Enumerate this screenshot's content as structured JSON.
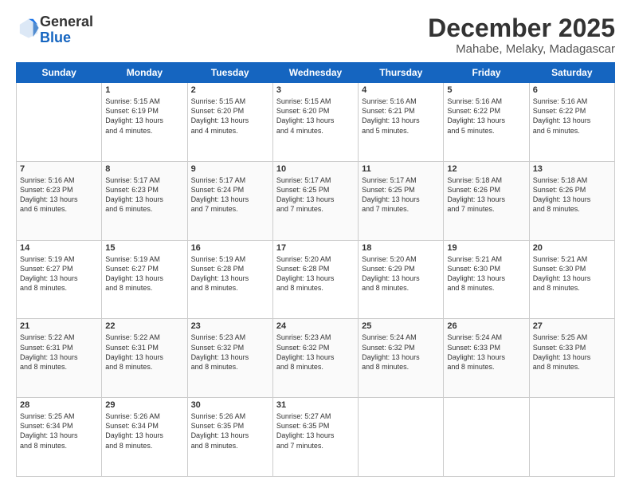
{
  "header": {
    "logo_general": "General",
    "logo_blue": "Blue",
    "title": "December 2025",
    "subtitle": "Mahabe, Melaky, Madagascar"
  },
  "days_of_week": [
    "Sunday",
    "Monday",
    "Tuesday",
    "Wednesday",
    "Thursday",
    "Friday",
    "Saturday"
  ],
  "weeks": [
    [
      {
        "day": "",
        "text": ""
      },
      {
        "day": "1",
        "text": "Sunrise: 5:15 AM\nSunset: 6:19 PM\nDaylight: 13 hours\nand 4 minutes."
      },
      {
        "day": "2",
        "text": "Sunrise: 5:15 AM\nSunset: 6:20 PM\nDaylight: 13 hours\nand 4 minutes."
      },
      {
        "day": "3",
        "text": "Sunrise: 5:15 AM\nSunset: 6:20 PM\nDaylight: 13 hours\nand 4 minutes."
      },
      {
        "day": "4",
        "text": "Sunrise: 5:16 AM\nSunset: 6:21 PM\nDaylight: 13 hours\nand 5 minutes."
      },
      {
        "day": "5",
        "text": "Sunrise: 5:16 AM\nSunset: 6:22 PM\nDaylight: 13 hours\nand 5 minutes."
      },
      {
        "day": "6",
        "text": "Sunrise: 5:16 AM\nSunset: 6:22 PM\nDaylight: 13 hours\nand 6 minutes."
      }
    ],
    [
      {
        "day": "7",
        "text": "Sunrise: 5:16 AM\nSunset: 6:23 PM\nDaylight: 13 hours\nand 6 minutes."
      },
      {
        "day": "8",
        "text": "Sunrise: 5:17 AM\nSunset: 6:23 PM\nDaylight: 13 hours\nand 6 minutes."
      },
      {
        "day": "9",
        "text": "Sunrise: 5:17 AM\nSunset: 6:24 PM\nDaylight: 13 hours\nand 7 minutes."
      },
      {
        "day": "10",
        "text": "Sunrise: 5:17 AM\nSunset: 6:25 PM\nDaylight: 13 hours\nand 7 minutes."
      },
      {
        "day": "11",
        "text": "Sunrise: 5:17 AM\nSunset: 6:25 PM\nDaylight: 13 hours\nand 7 minutes."
      },
      {
        "day": "12",
        "text": "Sunrise: 5:18 AM\nSunset: 6:26 PM\nDaylight: 13 hours\nand 7 minutes."
      },
      {
        "day": "13",
        "text": "Sunrise: 5:18 AM\nSunset: 6:26 PM\nDaylight: 13 hours\nand 8 minutes."
      }
    ],
    [
      {
        "day": "14",
        "text": "Sunrise: 5:19 AM\nSunset: 6:27 PM\nDaylight: 13 hours\nand 8 minutes."
      },
      {
        "day": "15",
        "text": "Sunrise: 5:19 AM\nSunset: 6:27 PM\nDaylight: 13 hours\nand 8 minutes."
      },
      {
        "day": "16",
        "text": "Sunrise: 5:19 AM\nSunset: 6:28 PM\nDaylight: 13 hours\nand 8 minutes."
      },
      {
        "day": "17",
        "text": "Sunrise: 5:20 AM\nSunset: 6:28 PM\nDaylight: 13 hours\nand 8 minutes."
      },
      {
        "day": "18",
        "text": "Sunrise: 5:20 AM\nSunset: 6:29 PM\nDaylight: 13 hours\nand 8 minutes."
      },
      {
        "day": "19",
        "text": "Sunrise: 5:21 AM\nSunset: 6:30 PM\nDaylight: 13 hours\nand 8 minutes."
      },
      {
        "day": "20",
        "text": "Sunrise: 5:21 AM\nSunset: 6:30 PM\nDaylight: 13 hours\nand 8 minutes."
      }
    ],
    [
      {
        "day": "21",
        "text": "Sunrise: 5:22 AM\nSunset: 6:31 PM\nDaylight: 13 hours\nand 8 minutes."
      },
      {
        "day": "22",
        "text": "Sunrise: 5:22 AM\nSunset: 6:31 PM\nDaylight: 13 hours\nand 8 minutes."
      },
      {
        "day": "23",
        "text": "Sunrise: 5:23 AM\nSunset: 6:32 PM\nDaylight: 13 hours\nand 8 minutes."
      },
      {
        "day": "24",
        "text": "Sunrise: 5:23 AM\nSunset: 6:32 PM\nDaylight: 13 hours\nand 8 minutes."
      },
      {
        "day": "25",
        "text": "Sunrise: 5:24 AM\nSunset: 6:32 PM\nDaylight: 13 hours\nand 8 minutes."
      },
      {
        "day": "26",
        "text": "Sunrise: 5:24 AM\nSunset: 6:33 PM\nDaylight: 13 hours\nand 8 minutes."
      },
      {
        "day": "27",
        "text": "Sunrise: 5:25 AM\nSunset: 6:33 PM\nDaylight: 13 hours\nand 8 minutes."
      }
    ],
    [
      {
        "day": "28",
        "text": "Sunrise: 5:25 AM\nSunset: 6:34 PM\nDaylight: 13 hours\nand 8 minutes."
      },
      {
        "day": "29",
        "text": "Sunrise: 5:26 AM\nSunset: 6:34 PM\nDaylight: 13 hours\nand 8 minutes."
      },
      {
        "day": "30",
        "text": "Sunrise: 5:26 AM\nSunset: 6:35 PM\nDaylight: 13 hours\nand 8 minutes."
      },
      {
        "day": "31",
        "text": "Sunrise: 5:27 AM\nSunset: 6:35 PM\nDaylight: 13 hours\nand 7 minutes."
      },
      {
        "day": "",
        "text": ""
      },
      {
        "day": "",
        "text": ""
      },
      {
        "day": "",
        "text": ""
      }
    ]
  ]
}
